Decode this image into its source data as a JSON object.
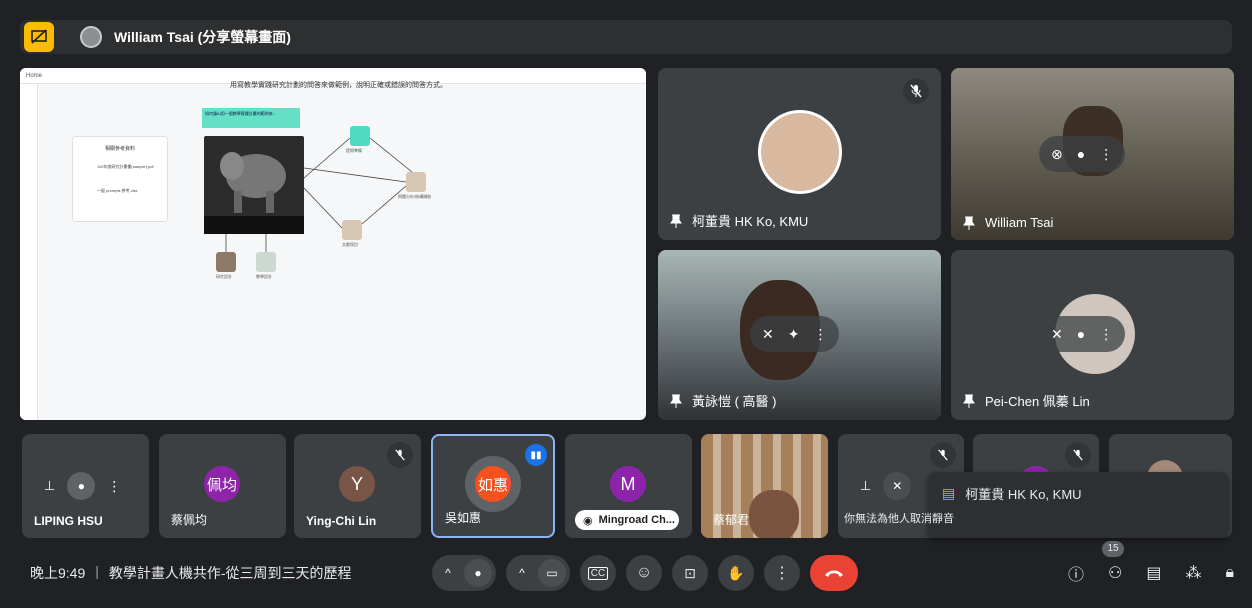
{
  "topbar": {
    "presenter_name": "William Tsai (分享螢幕畫面)"
  },
  "share": {
    "doc_title": "用寫教學實踐研究計劃的問答來做範例，說明正確或錯誤的問答方式。",
    "nav_home": "Home",
    "panel_title": "相關參考資料",
    "file1": "110年度研究計畫書(sample).pdf",
    "file2": "一般 prompts 參考.xlsx",
    "header_note": "如何讓AI用一個教學實踐計畫的範例來...",
    "node_labels": [
      "提問準備",
      "問題分析/結構擷取",
      "文獻探討",
      "研究設計",
      "教學設計"
    ]
  },
  "participants": {
    "ko": "柯董貴 HK Ko, KMU",
    "william": "William Tsai",
    "huang": "黃詠愷 ( 高醫 )",
    "peichen": "Pei-Chen 佩蓁 Lin",
    "liping": "LIPING HSU",
    "peijun_initial": "佩均",
    "peijun": "蔡佩均",
    "yingchi_initial": "Y",
    "yingchi": "Ying-Chi Lin",
    "ruhui_initial": "如惠",
    "ruhui": "吳如惠",
    "mingroad_initial": "M",
    "mingroad": "Mingroad Ch...",
    "tsai": "蔡郁君",
    "toast_name": "柯董貴 HK Ko, KMU",
    "toast_msg": "你無法為他人取消靜音"
  },
  "bottom": {
    "time": "晚上9:49",
    "divider": "|",
    "meeting_title": "教學計畫人機共作-從三周到三天的歷程",
    "participant_count": "15"
  },
  "colors": {
    "peijun": "#8e24aa",
    "yingchi": "#795548",
    "ruhui": "#f4511e",
    "mingroad": "#8e24aa",
    "end_call": "#ea4335",
    "present": "#fbbc04"
  }
}
